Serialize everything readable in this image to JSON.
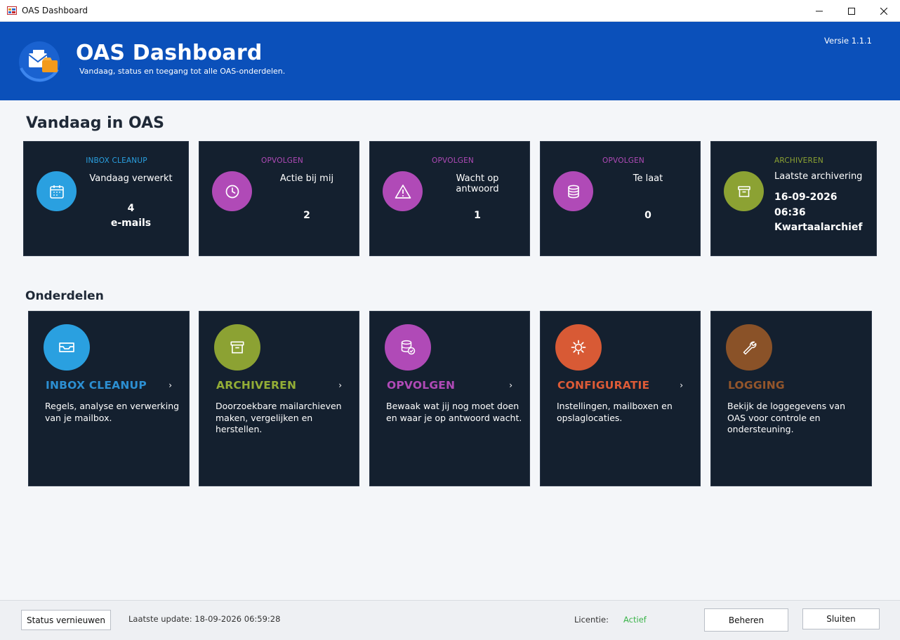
{
  "window": {
    "title": "OAS Dashboard"
  },
  "header": {
    "title": "OAS Dashboard",
    "subtitle": "Vandaag, status en toegang tot alle OAS-onderdelen.",
    "version": "Versie 1.1.1"
  },
  "today": {
    "title": "Vandaag in OAS",
    "cards": [
      {
        "category": "INBOX CLEANUP",
        "label": "Vandaag verwerkt",
        "value": "4",
        "unit": "e-mails",
        "icon": "calendar-icon",
        "color": "#2aa0e0"
      },
      {
        "category": "OPVOLGEN",
        "label": "Actie bij mij",
        "value": "2",
        "icon": "clock-icon",
        "color": "#b04ab7"
      },
      {
        "category": "OPVOLGEN",
        "label": "Wacht op antwoord",
        "value": "1",
        "icon": "warning-icon",
        "color": "#b04ab7"
      },
      {
        "category": "OPVOLGEN",
        "label": "Te laat",
        "value": "0",
        "icon": "database-icon",
        "color": "#b04ab7"
      },
      {
        "category": "ARCHIVEREN",
        "label": "Laatste archivering",
        "date": "16-09-2026",
        "time": "06:36",
        "name": "Kwartaalarchief",
        "icon": "archive-box-icon",
        "color": "#8ca233"
      }
    ]
  },
  "modules": {
    "title": "Onderdelen",
    "items": [
      {
        "title": "INBOX CLEANUP",
        "desc": "Regels, analyse en verwerking van je mailbox.",
        "icon": "inbox-tray-icon",
        "color": "#2aa0e0",
        "title_color": "#2c8fd2"
      },
      {
        "title": "ARCHIVEREN",
        "desc": "Doorzoekbare mailarchieven maken, vergelijken en herstellen.",
        "icon": "archive-box-icon",
        "color": "#8ca233",
        "title_color": "#93ad36"
      },
      {
        "title": "OPVOLGEN",
        "desc": "Bewaak wat jij nog moet doen en waar je op antwoord wacht.",
        "icon": "database-check-icon",
        "color": "#b04ab7",
        "title_color": "#b04ab7"
      },
      {
        "title": "CONFIGURATIE",
        "desc": "Instellingen, mailboxen en opslaglocaties.",
        "icon": "gear-icon",
        "color": "#d85a35",
        "title_color": "#dd5b37"
      },
      {
        "title": "LOGGING",
        "desc": "Bekijk de loggegevens van OAS voor controle en ondersteuning.",
        "icon": "wrench-icon",
        "color": "#8a5228",
        "title_color": "#94562b"
      }
    ]
  },
  "footer": {
    "refresh_label": "Status vernieuwen",
    "last_update": "Laatste update: 18-09-2026 06:59:28",
    "license_label": "Licentie:",
    "license_status": "Actief",
    "license_color": "#3bb44a",
    "manage_label": "Beheren",
    "close_label": "Sluiten"
  }
}
